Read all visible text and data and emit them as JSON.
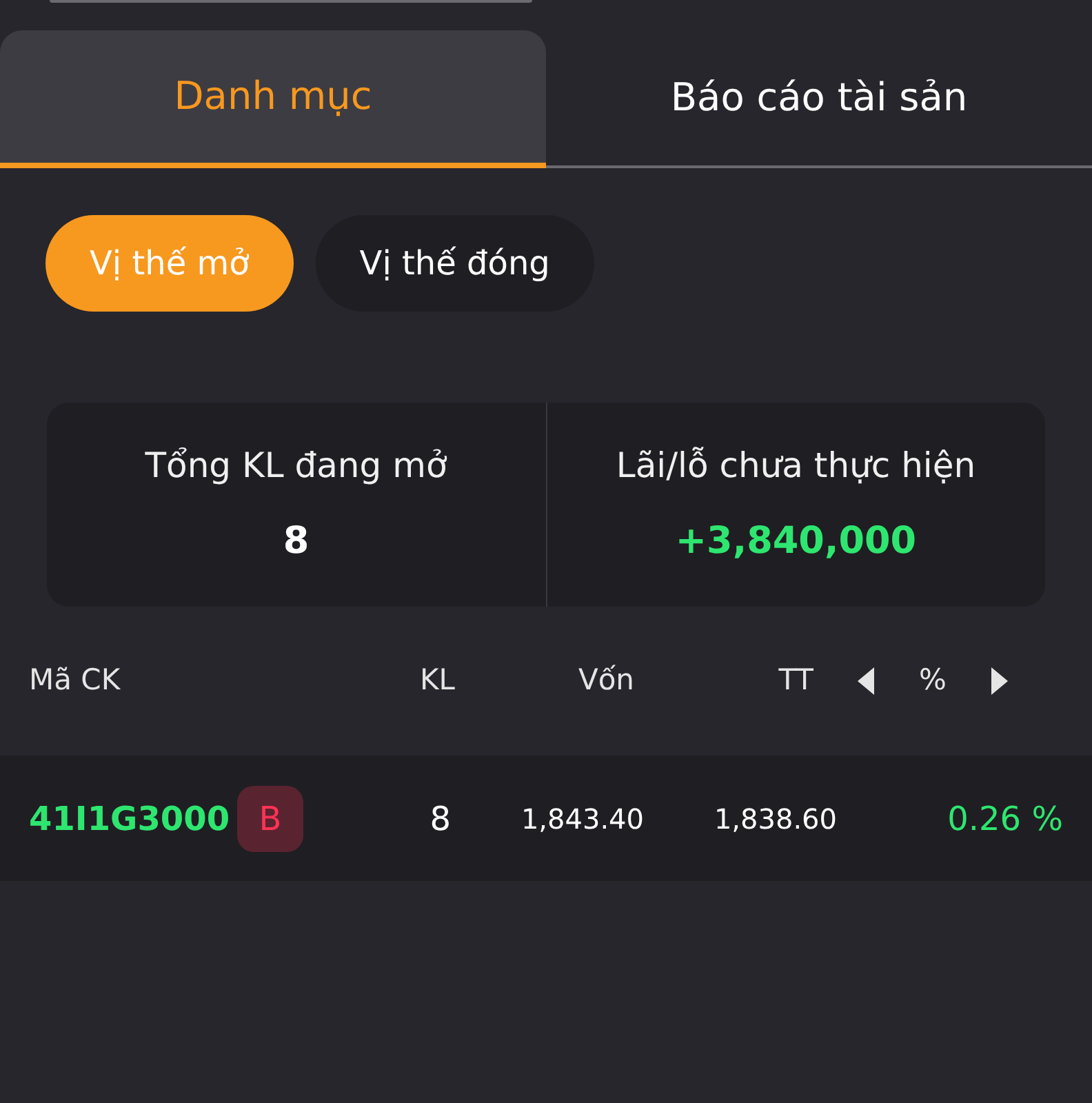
{
  "tabs": [
    {
      "label": "Danh mục",
      "selected": true
    },
    {
      "label": "Báo cáo tài sản",
      "selected": false
    }
  ],
  "filters": [
    {
      "label": "Vị thế mở",
      "selected": true
    },
    {
      "label": "Vị thế đóng",
      "selected": false
    }
  ],
  "summary": [
    {
      "label": "Tổng KL đang mở",
      "value": "8",
      "kind": "plain"
    },
    {
      "label": "Lãi/lỗ chưa thực hiện",
      "value": "+3,840,000",
      "kind": "gain"
    }
  ],
  "table": {
    "columns": [
      "Mã CK",
      "KL",
      "Vốn",
      "TT",
      "%"
    ],
    "rows": [
      {
        "symbol": "41I1G3000",
        "side": "B",
        "qty": "8",
        "cost": "1,843.40",
        "price": "1,838.60",
        "pct": "0.26 %"
      }
    ]
  }
}
